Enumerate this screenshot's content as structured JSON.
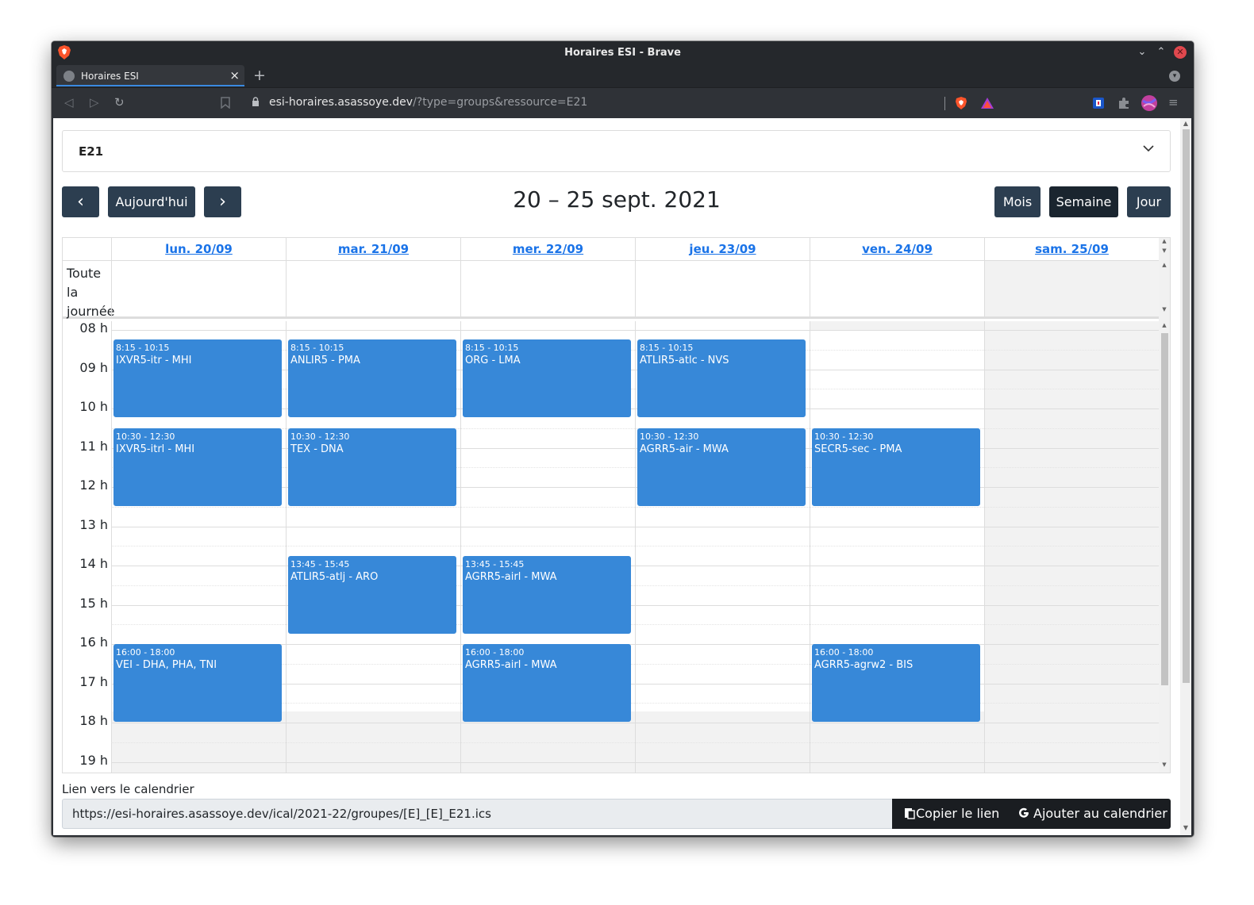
{
  "browser": {
    "window_title": "Horaires ESI - Brave",
    "tab_title": "Horaires ESI",
    "new_tab": "+",
    "url_host": "esi-horaires.asassoye.dev",
    "url_rest": "/?type=groups&ressource=E21",
    "window_controls": {
      "minimize": "⌄",
      "maximize": "⌃",
      "close": "✕"
    }
  },
  "selector": {
    "value": "E21"
  },
  "nav": {
    "prev": "‹",
    "today": "Aujourd'hui",
    "next": "›"
  },
  "calendar_title": "20 – 25 sept. 2021",
  "views": {
    "month": "Mois",
    "week": "Semaine",
    "day": "Jour",
    "active": "Semaine"
  },
  "days": [
    "lun. 20/09",
    "mar. 21/09",
    "mer. 22/09",
    "jeu. 23/09",
    "ven. 24/09",
    "sam. 25/09"
  ],
  "allday_label": "Toute la journée",
  "hours": [
    "08 h",
    "09 h",
    "10 h",
    "11 h",
    "12 h",
    "13 h",
    "14 h",
    "15 h",
    "16 h",
    "17 h",
    "18 h",
    "19 h"
  ],
  "events": [
    {
      "day": 0,
      "start": "8:15",
      "end": "10:15",
      "time": "8:15 - 10:15",
      "title": "IXVR5-itr - MHI"
    },
    {
      "day": 1,
      "start": "8:15",
      "end": "10:15",
      "time": "8:15 - 10:15",
      "title": "ANLIR5 - PMA"
    },
    {
      "day": 2,
      "start": "8:15",
      "end": "10:15",
      "time": "8:15 - 10:15",
      "title": "ORG - LMA"
    },
    {
      "day": 3,
      "start": "8:15",
      "end": "10:15",
      "time": "8:15 - 10:15",
      "title": "ATLIR5-atlc - NVS"
    },
    {
      "day": 0,
      "start": "10:30",
      "end": "12:30",
      "time": "10:30 - 12:30",
      "title": "IXVR5-itrl - MHI"
    },
    {
      "day": 1,
      "start": "10:30",
      "end": "12:30",
      "time": "10:30 - 12:30",
      "title": "TEX - DNA"
    },
    {
      "day": 3,
      "start": "10:30",
      "end": "12:30",
      "time": "10:30 - 12:30",
      "title": "AGRR5-air - MWA"
    },
    {
      "day": 4,
      "start": "10:30",
      "end": "12:30",
      "time": "10:30 - 12:30",
      "title": "SECR5-sec - PMA"
    },
    {
      "day": 1,
      "start": "13:45",
      "end": "15:45",
      "time": "13:45 - 15:45",
      "title": "ATLIR5-atlj - ARO"
    },
    {
      "day": 2,
      "start": "13:45",
      "end": "15:45",
      "time": "13:45 - 15:45",
      "title": "AGRR5-airl - MWA"
    },
    {
      "day": 0,
      "start": "16:00",
      "end": "18:00",
      "time": "16:00 - 18:00",
      "title": "VEI - DHA, PHA, TNI"
    },
    {
      "day": 2,
      "start": "16:00",
      "end": "18:00",
      "time": "16:00 - 18:00",
      "title": "AGRR5-airl - MWA"
    },
    {
      "day": 4,
      "start": "16:00",
      "end": "18:00",
      "time": "16:00 - 18:00",
      "title": "AGRR5-agrw2 - BIS"
    }
  ],
  "link": {
    "label": "Lien vers le calendrier",
    "url": "https://esi-horaires.asassoye.dev/ical/2021-22/groupes/[E]_[E]_E21.ics",
    "copy": "Copier le lien",
    "add": "Ajouter au calendrier"
  },
  "icons": {
    "back": "back-arrow-icon",
    "forward": "forward-arrow-icon",
    "reload": "reload-icon",
    "bookmark": "bookmark-icon",
    "lock": "lock-icon",
    "brave_shield": "brave-shield-icon",
    "rewards": "brave-rewards-icon",
    "extension": "puzzle-icon",
    "menu": "hamburger-menu-icon",
    "chevron": "chevron-down-icon",
    "clipboard": "clipboard-icon",
    "google": "google-icon"
  },
  "colors": {
    "event": "#3788d8",
    "button": "#2c3e50",
    "button_active": "#1a252f",
    "link": "#1a73e8",
    "weekend_shade": "#f2f2f2"
  }
}
